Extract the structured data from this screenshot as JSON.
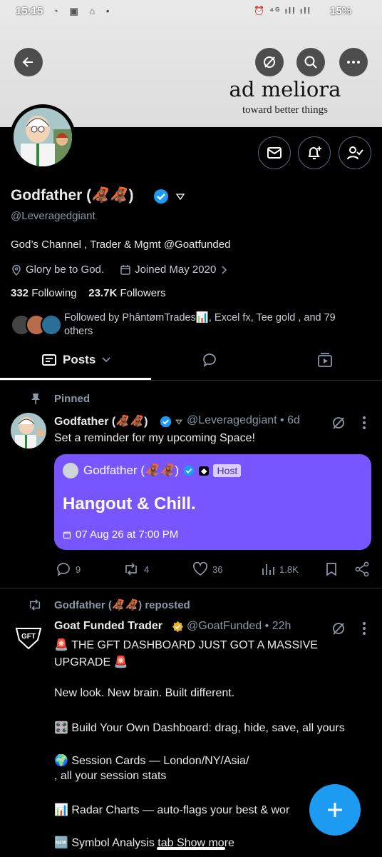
{
  "status_bar": {
    "time": "15:15",
    "battery": "15%",
    "icons": "◔ ▣ ⌂ •",
    "right_icons": "⏰ ⁴ᴳ ıll ıll"
  },
  "banner": {
    "motto": "ad meliora",
    "motto_sub": "toward better things"
  },
  "top_nav": {
    "back_icon": "arrow-left-icon",
    "grok_icon": "slash-circle-icon",
    "search_icon": "search-icon",
    "more_icon": "more-icon"
  },
  "profile": {
    "name": "Godfather (🦧🦧)",
    "handle": "@Leveragedgiant",
    "bio": "God’s Channel , Trader & Mgmt @Goatfunded",
    "location": "Glory be to God.",
    "joined": "Joined May 2020",
    "following_count": "332",
    "following_label": "Following",
    "followers_count": "23.7K",
    "followers_label": "Followers",
    "followed_by": "Followed by PhântømTrades📊, Excel fx, Tee gold  , and 79 others"
  },
  "tabs": {
    "posts_label": "Posts"
  },
  "pinned_post": {
    "pinned_label": "Pinned",
    "author": "Godfather (🦧🦧)",
    "handle": "@Leveragedgiant",
    "time": "6d",
    "text": "Set a reminder for my upcoming Space!",
    "space": {
      "host_name": "Godfather (🦧🦧)",
      "host_badge": "Host",
      "title": "Hangout & Chill.",
      "datetime": "07 Aug 26 at 7:00 PM"
    },
    "stats": {
      "replies": "9",
      "reposts": "4",
      "likes": "36",
      "views": "1.8K"
    }
  },
  "repost": {
    "reposted_by": "Godfather (🦧🦧) reposted",
    "author": "Goat Funded Trader",
    "handle": "@GoatFunded",
    "time": "22h",
    "lines": [
      "🚨 THE GFT DASHBOARD JUST GOT A MASSIVE",
      "UPGRADE 🚨",
      "New look. New brain. Built different.",
      "🎛️ Build Your Own Dashboard: drag, hide, save, all yours",
      "🌍 Session Cards — London/NY/Asia/",
      ", all your session stats",
      "📊 Radar Charts — auto-flags your best & wor",
      "🆕 Symbol Analysis tab"
    ],
    "show_more": "Show more",
    "logo_text": "GFT"
  },
  "colors": {
    "accent": "#1d9bf0",
    "space_purple": "#7856ff",
    "verified_gold": "#e8b02c"
  }
}
